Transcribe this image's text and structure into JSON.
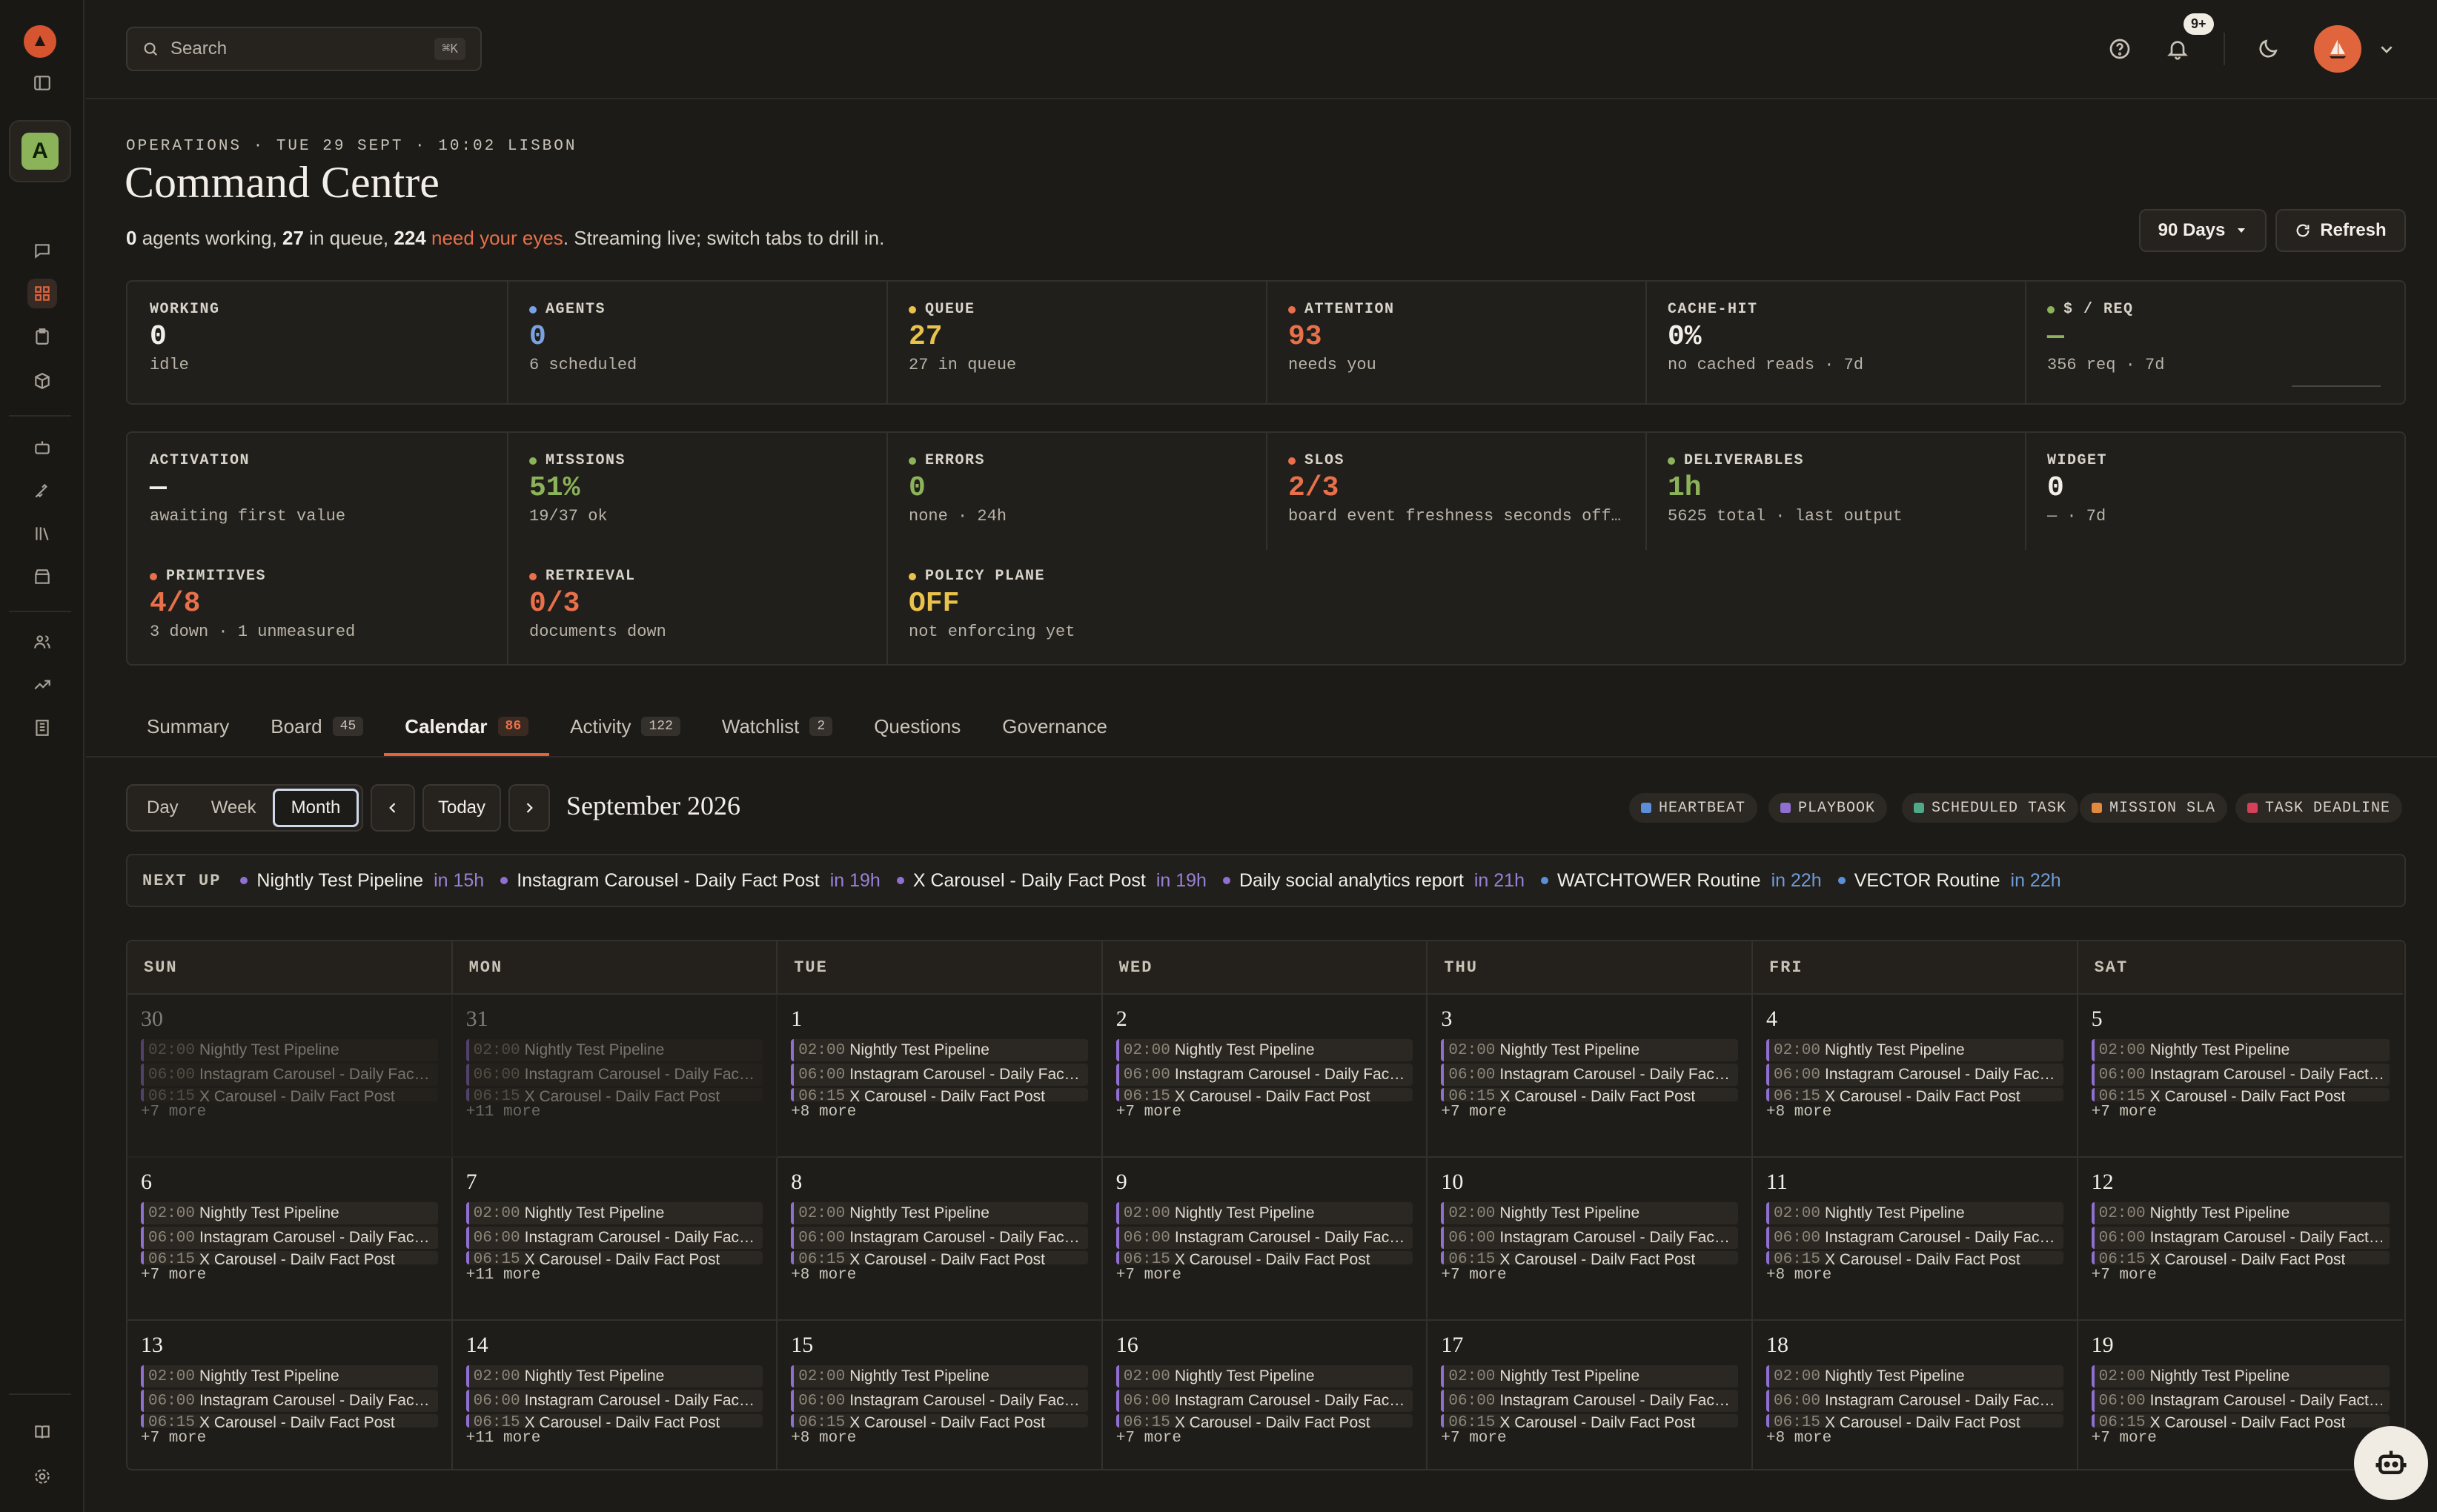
{
  "colors": {
    "accent": "#e0653d",
    "attention": "#e8704a",
    "green": "#8bb35a",
    "yellow": "#e8c24a",
    "blue": "#7aa2e0",
    "purple": "#8f6fd0"
  },
  "search": {
    "label": "Search",
    "shortcut": "⌘K"
  },
  "top": {
    "notifications_badge": "9+"
  },
  "header": {
    "eyebrow": "OPERATIONS · TUE 29 SEPT · 10:02 LISBON",
    "title": "Command Centre",
    "sub_working": "0",
    "sub_working_label": " agents working, ",
    "sub_queue": "27",
    "sub_queue_label": " in queue, ",
    "sub_attention": "224",
    "sub_attention_label": "need your eyes",
    "sub_tail": ". Streaming live; switch tabs to drill in.",
    "range_label": "90 Days",
    "refresh_label": "Refresh"
  },
  "stats_row1": [
    {
      "label": "WORKING",
      "value": "0",
      "sub": "idle",
      "dot": "",
      "value_color": "#f3efe8"
    },
    {
      "label": "AGENTS",
      "value": "0",
      "sub": "6 scheduled",
      "dot": "#7aa2e0",
      "value_color": "#7aa2e0"
    },
    {
      "label": "QUEUE",
      "value": "27",
      "sub": "27 in queue",
      "dot": "#e8c24a",
      "value_color": "#e8c24a"
    },
    {
      "label": "ATTENTION",
      "value": "93",
      "sub": "needs you",
      "dot": "#e8704a",
      "value_color": "#e8704a"
    },
    {
      "label": "CACHE-HIT",
      "value": "0%",
      "sub": "no cached reads · 7d",
      "dot": "",
      "value_color": "#f3efe8"
    },
    {
      "label": "$ / REQ",
      "value": "—",
      "sub": "356 req · 7d",
      "dot": "#8bb35a",
      "value_color": "#8bb35a"
    }
  ],
  "stats_row2": [
    {
      "label": "ACTIVATION",
      "value": "—",
      "sub": "awaiting first value",
      "dot": "",
      "value_color": "#f3efe8"
    },
    {
      "label": "MISSIONS",
      "value": "51%",
      "sub": "19/37 ok",
      "dot": "#8bb35a",
      "value_color": "#8bb35a"
    },
    {
      "label": "ERRORS",
      "value": "0",
      "sub": "none · 24h",
      "dot": "#8bb35a",
      "value_color": "#8bb35a"
    },
    {
      "label": "SLOS",
      "value": "2/3",
      "sub": "board event freshness seconds off…",
      "dot": "#e8704a",
      "value_color": "#e8704a"
    },
    {
      "label": "DELIVERABLES",
      "value": "1h",
      "sub": "5625 total · last output",
      "dot": "#8bb35a",
      "value_color": "#8bb35a"
    },
    {
      "label": "WIDGET",
      "value": "0",
      "sub": "— · 7d",
      "dot": "",
      "value_color": "#f3efe8"
    }
  ],
  "stats_row3": [
    {
      "label": "PRIMITIVES",
      "value": "4/8",
      "sub": "3 down · 1 unmeasured",
      "dot": "#e8704a",
      "value_color": "#e8704a"
    },
    {
      "label": "RETRIEVAL",
      "value": "0/3",
      "sub": "documents down",
      "dot": "#e8704a",
      "value_color": "#e8704a"
    },
    {
      "label": "POLICY PLANE",
      "value": "OFF",
      "sub": "not enforcing yet",
      "dot": "#e8c24a",
      "value_color": "#e8c24a"
    }
  ],
  "tabs": [
    {
      "label": "Summary",
      "count": ""
    },
    {
      "label": "Board",
      "count": "45"
    },
    {
      "label": "Calendar",
      "count": "86",
      "active": true
    },
    {
      "label": "Activity",
      "count": "122"
    },
    {
      "label": "Watchlist",
      "count": "2"
    },
    {
      "label": "Questions",
      "count": ""
    },
    {
      "label": "Governance",
      "count": ""
    }
  ],
  "calendar": {
    "views": [
      "Day",
      "Week",
      "Month"
    ],
    "active_view": "Month",
    "today_label": "Today",
    "month_title": "September 2026",
    "legend": [
      {
        "label": "HEARTBEAT",
        "color": "#5b8fd8"
      },
      {
        "label": "PLAYBOOK",
        "color": "#8f6fd0"
      },
      {
        "label": "SCHEDULED TASK",
        "color": "#4fa88a"
      },
      {
        "label": "MISSION SLA",
        "color": "#e08a3d"
      },
      {
        "label": "TASK DEADLINE",
        "color": "#d8405a"
      }
    ],
    "next_up_label": "NEXT UP",
    "next_up": [
      {
        "name": "Nightly Test Pipeline",
        "when": "in 15h",
        "color": "#8f6fd0"
      },
      {
        "name": "Instagram Carousel - Daily Fact Post",
        "when": "in 19h",
        "color": "#8f6fd0"
      },
      {
        "name": "X Carousel - Daily Fact Post",
        "when": "in 19h",
        "color": "#8f6fd0"
      },
      {
        "name": "Daily social analytics report",
        "when": "in 21h",
        "color": "#8f6fd0"
      },
      {
        "name": "WATCHTOWER Routine",
        "when": "in 22h",
        "color": "#5b8fd8"
      },
      {
        "name": "VECTOR Routine",
        "when": "in 22h",
        "color": "#5b8fd8"
      }
    ],
    "weekdays": [
      "SUN",
      "MON",
      "TUE",
      "WED",
      "THU",
      "FRI",
      "SAT"
    ],
    "events": [
      {
        "time": "02:00",
        "name": "Nightly Test Pipeline"
      },
      {
        "time": "06:00",
        "name": "Instagram Carousel - Daily Fac…"
      },
      {
        "time": "06:15",
        "name": "X Carousel - Daily Fact Post"
      }
    ],
    "events_sat": [
      {
        "time": "02:00",
        "name": "Nightly Test Pipeline"
      },
      {
        "time": "06:00",
        "name": "Instagram Carousel - Daily Fact…"
      },
      {
        "time": "06:15",
        "name": "X Carousel - Daily Fact Post"
      }
    ],
    "weeks": [
      [
        {
          "day": "30",
          "more": "+7 more",
          "muted": true
        },
        {
          "day": "31",
          "more": "+11 more",
          "muted": true
        },
        {
          "day": "1",
          "more": "+8 more"
        },
        {
          "day": "2",
          "more": "+7 more"
        },
        {
          "day": "3",
          "more": "+7 more"
        },
        {
          "day": "4",
          "more": "+8 more"
        },
        {
          "day": "5",
          "more": "+7 more"
        }
      ],
      [
        {
          "day": "6",
          "more": "+7 more"
        },
        {
          "day": "7",
          "more": "+11 more"
        },
        {
          "day": "8",
          "more": "+8 more"
        },
        {
          "day": "9",
          "more": "+7 more"
        },
        {
          "day": "10",
          "more": "+7 more"
        },
        {
          "day": "11",
          "more": "+8 more"
        },
        {
          "day": "12",
          "more": "+7 more"
        }
      ],
      [
        {
          "day": "13",
          "more": "+7 more"
        },
        {
          "day": "14",
          "more": "+11 more"
        },
        {
          "day": "15",
          "more": "+8 more"
        },
        {
          "day": "16",
          "more": "+7 more"
        },
        {
          "day": "17",
          "more": "+7 more"
        },
        {
          "day": "18",
          "more": "+8 more"
        },
        {
          "day": "19",
          "more": "+7 more"
        }
      ]
    ]
  },
  "workspace": {
    "initial": "A"
  }
}
